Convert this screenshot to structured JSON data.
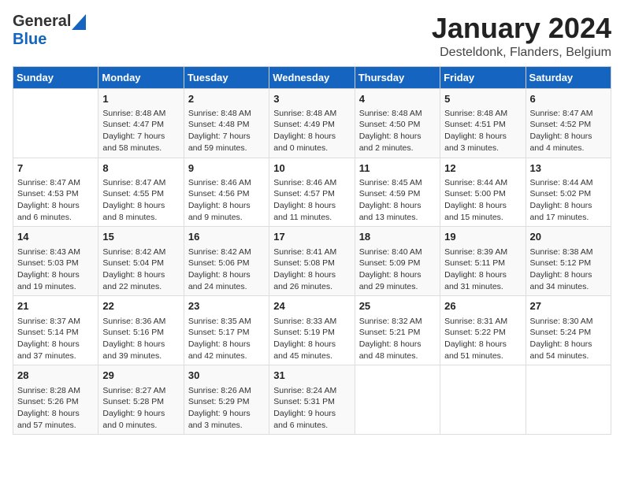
{
  "header": {
    "logo_general": "General",
    "logo_blue": "Blue",
    "title": "January 2024",
    "subtitle": "Desteldonk, Flanders, Belgium"
  },
  "days_of_week": [
    "Sunday",
    "Monday",
    "Tuesday",
    "Wednesday",
    "Thursday",
    "Friday",
    "Saturday"
  ],
  "weeks": [
    [
      {
        "day": "",
        "info": ""
      },
      {
        "day": "1",
        "info": "Sunrise: 8:48 AM\nSunset: 4:47 PM\nDaylight: 7 hours\nand 58 minutes."
      },
      {
        "day": "2",
        "info": "Sunrise: 8:48 AM\nSunset: 4:48 PM\nDaylight: 7 hours\nand 59 minutes."
      },
      {
        "day": "3",
        "info": "Sunrise: 8:48 AM\nSunset: 4:49 PM\nDaylight: 8 hours\nand 0 minutes."
      },
      {
        "day": "4",
        "info": "Sunrise: 8:48 AM\nSunset: 4:50 PM\nDaylight: 8 hours\nand 2 minutes."
      },
      {
        "day": "5",
        "info": "Sunrise: 8:48 AM\nSunset: 4:51 PM\nDaylight: 8 hours\nand 3 minutes."
      },
      {
        "day": "6",
        "info": "Sunrise: 8:47 AM\nSunset: 4:52 PM\nDaylight: 8 hours\nand 4 minutes."
      }
    ],
    [
      {
        "day": "7",
        "info": "Sunrise: 8:47 AM\nSunset: 4:53 PM\nDaylight: 8 hours\nand 6 minutes."
      },
      {
        "day": "8",
        "info": "Sunrise: 8:47 AM\nSunset: 4:55 PM\nDaylight: 8 hours\nand 8 minutes."
      },
      {
        "day": "9",
        "info": "Sunrise: 8:46 AM\nSunset: 4:56 PM\nDaylight: 8 hours\nand 9 minutes."
      },
      {
        "day": "10",
        "info": "Sunrise: 8:46 AM\nSunset: 4:57 PM\nDaylight: 8 hours\nand 11 minutes."
      },
      {
        "day": "11",
        "info": "Sunrise: 8:45 AM\nSunset: 4:59 PM\nDaylight: 8 hours\nand 13 minutes."
      },
      {
        "day": "12",
        "info": "Sunrise: 8:44 AM\nSunset: 5:00 PM\nDaylight: 8 hours\nand 15 minutes."
      },
      {
        "day": "13",
        "info": "Sunrise: 8:44 AM\nSunset: 5:02 PM\nDaylight: 8 hours\nand 17 minutes."
      }
    ],
    [
      {
        "day": "14",
        "info": "Sunrise: 8:43 AM\nSunset: 5:03 PM\nDaylight: 8 hours\nand 19 minutes."
      },
      {
        "day": "15",
        "info": "Sunrise: 8:42 AM\nSunset: 5:04 PM\nDaylight: 8 hours\nand 22 minutes."
      },
      {
        "day": "16",
        "info": "Sunrise: 8:42 AM\nSunset: 5:06 PM\nDaylight: 8 hours\nand 24 minutes."
      },
      {
        "day": "17",
        "info": "Sunrise: 8:41 AM\nSunset: 5:08 PM\nDaylight: 8 hours\nand 26 minutes."
      },
      {
        "day": "18",
        "info": "Sunrise: 8:40 AM\nSunset: 5:09 PM\nDaylight: 8 hours\nand 29 minutes."
      },
      {
        "day": "19",
        "info": "Sunrise: 8:39 AM\nSunset: 5:11 PM\nDaylight: 8 hours\nand 31 minutes."
      },
      {
        "day": "20",
        "info": "Sunrise: 8:38 AM\nSunset: 5:12 PM\nDaylight: 8 hours\nand 34 minutes."
      }
    ],
    [
      {
        "day": "21",
        "info": "Sunrise: 8:37 AM\nSunset: 5:14 PM\nDaylight: 8 hours\nand 37 minutes."
      },
      {
        "day": "22",
        "info": "Sunrise: 8:36 AM\nSunset: 5:16 PM\nDaylight: 8 hours\nand 39 minutes."
      },
      {
        "day": "23",
        "info": "Sunrise: 8:35 AM\nSunset: 5:17 PM\nDaylight: 8 hours\nand 42 minutes."
      },
      {
        "day": "24",
        "info": "Sunrise: 8:33 AM\nSunset: 5:19 PM\nDaylight: 8 hours\nand 45 minutes."
      },
      {
        "day": "25",
        "info": "Sunrise: 8:32 AM\nSunset: 5:21 PM\nDaylight: 8 hours\nand 48 minutes."
      },
      {
        "day": "26",
        "info": "Sunrise: 8:31 AM\nSunset: 5:22 PM\nDaylight: 8 hours\nand 51 minutes."
      },
      {
        "day": "27",
        "info": "Sunrise: 8:30 AM\nSunset: 5:24 PM\nDaylight: 8 hours\nand 54 minutes."
      }
    ],
    [
      {
        "day": "28",
        "info": "Sunrise: 8:28 AM\nSunset: 5:26 PM\nDaylight: 8 hours\nand 57 minutes."
      },
      {
        "day": "29",
        "info": "Sunrise: 8:27 AM\nSunset: 5:28 PM\nDaylight: 9 hours\nand 0 minutes."
      },
      {
        "day": "30",
        "info": "Sunrise: 8:26 AM\nSunset: 5:29 PM\nDaylight: 9 hours\nand 3 minutes."
      },
      {
        "day": "31",
        "info": "Sunrise: 8:24 AM\nSunset: 5:31 PM\nDaylight: 9 hours\nand 6 minutes."
      },
      {
        "day": "",
        "info": ""
      },
      {
        "day": "",
        "info": ""
      },
      {
        "day": "",
        "info": ""
      }
    ]
  ]
}
